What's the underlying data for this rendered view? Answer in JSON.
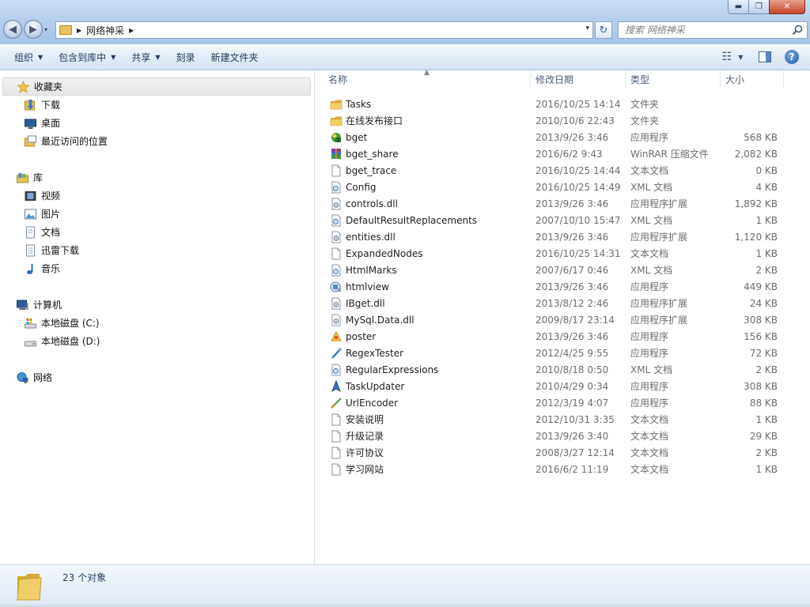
{
  "window": {
    "minimize_glyph": "▬",
    "maximize_glyph": "❐",
    "close_glyph": "✕"
  },
  "nav": {
    "back_glyph": "◀",
    "forward_glyph": "▶",
    "history_glyph": "▾"
  },
  "address": {
    "path": "网络神采",
    "separator": "▶",
    "drop_glyph": "▾"
  },
  "refresh_glyph": "↻",
  "search": {
    "placeholder": "搜索 网络神采"
  },
  "toolbar": {
    "organize": "组织",
    "include_library": "包含到库中",
    "share": "共享",
    "burn": "刻录",
    "new_folder": "新建文件夹",
    "caret": "▼",
    "view_glyph": "☷",
    "view_caret": "▼",
    "preview_glyph": "▢",
    "help_glyph": "?"
  },
  "sidebar": {
    "favorites": {
      "label": "收藏夹",
      "items": [
        "下载",
        "桌面",
        "最近访问的位置"
      ]
    },
    "libraries": {
      "label": "库",
      "items": [
        "视频",
        "图片",
        "文档",
        "迅雷下载",
        "音乐"
      ]
    },
    "computer": {
      "label": "计算机",
      "items": [
        "本地磁盘 (C:)",
        "本地磁盘 (D:)"
      ]
    },
    "network": {
      "label": "网络"
    }
  },
  "columns": {
    "name": "名称",
    "date": "修改日期",
    "type": "类型",
    "size": "大小",
    "sort_glyph": "▲"
  },
  "files": [
    {
      "name": "Tasks",
      "date": "2016/10/25 14:14",
      "type": "文件夹",
      "size": "",
      "icon": "folder-icon"
    },
    {
      "name": "在线发布接口",
      "date": "2010/10/6 22:43",
      "type": "文件夹",
      "size": "",
      "icon": "folder-icon"
    },
    {
      "name": "bget",
      "date": "2013/9/26 3:46",
      "type": "应用程序",
      "size": "568 KB",
      "icon": "app-icon"
    },
    {
      "name": "bget_share",
      "date": "2016/6/2 9:43",
      "type": "WinRAR 压缩文件",
      "size": "2,082 KB",
      "icon": "archive-icon"
    },
    {
      "name": "bget_trace",
      "date": "2016/10/25 14:44",
      "type": "文本文档",
      "size": "0 KB",
      "icon": "text-file-icon"
    },
    {
      "name": "Config",
      "date": "2016/10/25 14:49",
      "type": "XML 文档",
      "size": "4 KB",
      "icon": "xml-file-icon"
    },
    {
      "name": "controls.dll",
      "date": "2013/9/26 3:46",
      "type": "应用程序扩展",
      "size": "1,892 KB",
      "icon": "dll-file-icon"
    },
    {
      "name": "DefaultResultReplacements",
      "date": "2007/10/10 15:47",
      "type": "XML 文档",
      "size": "1 KB",
      "icon": "xml-file-icon"
    },
    {
      "name": "entities.dll",
      "date": "2013/9/26 3:46",
      "type": "应用程序扩展",
      "size": "1,120 KB",
      "icon": "dll-file-icon"
    },
    {
      "name": "ExpandedNodes",
      "date": "2016/10/25 14:31",
      "type": "文本文档",
      "size": "1 KB",
      "icon": "text-file-icon"
    },
    {
      "name": "HtmlMarks",
      "date": "2007/6/17 0:46",
      "type": "XML 文档",
      "size": "2 KB",
      "icon": "xml-file-icon"
    },
    {
      "name": "htmlview",
      "date": "2013/9/26 3:46",
      "type": "应用程序",
      "size": "449 KB",
      "icon": "htmlview-app-icon"
    },
    {
      "name": "IBget.dll",
      "date": "2013/8/12 2:46",
      "type": "应用程序扩展",
      "size": "24 KB",
      "icon": "dll-file-icon"
    },
    {
      "name": "MySql.Data.dll",
      "date": "2009/8/17 23:14",
      "type": "应用程序扩展",
      "size": "308 KB",
      "icon": "dll-file-icon"
    },
    {
      "name": "poster",
      "date": "2013/9/26 3:46",
      "type": "应用程序",
      "size": "156 KB",
      "icon": "poster-app-icon"
    },
    {
      "name": "RegexTester",
      "date": "2012/4/25 9:55",
      "type": "应用程序",
      "size": "72 KB",
      "icon": "regex-app-icon"
    },
    {
      "name": "RegularExpressions",
      "date": "2010/8/18 0:50",
      "type": "XML 文档",
      "size": "2 KB",
      "icon": "xml-file-icon"
    },
    {
      "name": "TaskUpdater",
      "date": "2010/4/29 0:34",
      "type": "应用程序",
      "size": "308 KB",
      "icon": "updater-app-icon"
    },
    {
      "name": "UrlEncoder",
      "date": "2012/3/19 4:07",
      "type": "应用程序",
      "size": "88 KB",
      "icon": "urlencoder-app-icon"
    },
    {
      "name": "安装说明",
      "date": "2012/10/31 3:35",
      "type": "文本文档",
      "size": "1 KB",
      "icon": "text-file-icon"
    },
    {
      "name": "升级记录",
      "date": "2013/9/26 3:40",
      "type": "文本文档",
      "size": "29 KB",
      "icon": "text-file-icon"
    },
    {
      "name": "许可协议",
      "date": "2008/3/27 12:14",
      "type": "文本文档",
      "size": "2 KB",
      "icon": "text-file-icon"
    },
    {
      "name": "学习网站",
      "date": "2016/6/2 11:19",
      "type": "文本文档",
      "size": "1 KB",
      "icon": "text-file-icon"
    }
  ],
  "status": {
    "count": "23 个对象"
  }
}
